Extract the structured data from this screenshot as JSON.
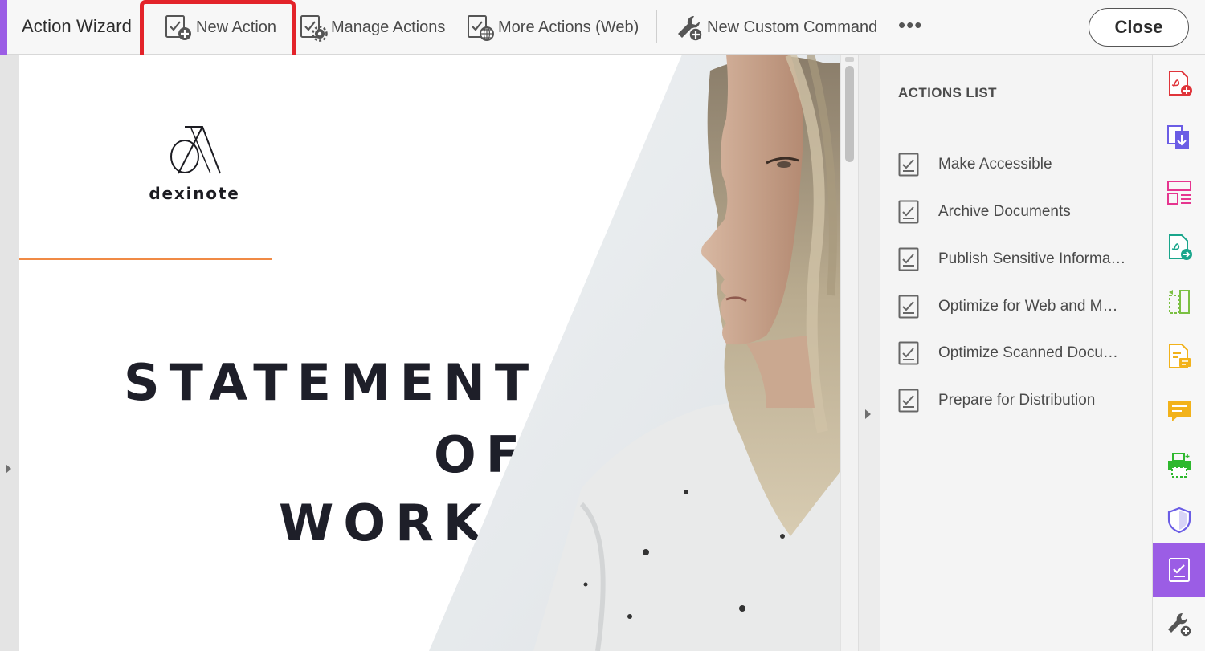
{
  "toolbar": {
    "title": "Action Wizard",
    "accent_color": "#9b5de5",
    "buttons": [
      {
        "label": "New Action",
        "icon": "checklist-plus-icon"
      },
      {
        "label": "Manage Actions",
        "icon": "checklist-gear-icon"
      },
      {
        "label": "More Actions (Web)",
        "icon": "checklist-globe-icon"
      },
      {
        "label": "New Custom Command",
        "icon": "wrench-plus-icon"
      }
    ],
    "more_label": "•••",
    "close_label": "Close",
    "highlight_color": "#e3232a"
  },
  "document": {
    "logo_text": "dexinote",
    "headline": [
      "STATEMENT",
      "OF",
      "WORK"
    ],
    "accent_line_color": "#f08a45"
  },
  "actions_panel": {
    "title": "ACTIONS LIST",
    "items": [
      "Make Accessible",
      "Archive Documents",
      "Publish Sensitive Informa…",
      "Optimize for Web and M…",
      "Optimize Scanned Docu…",
      "Prepare for Distribution"
    ]
  },
  "tools_rail": {
    "items": [
      {
        "icon": "create-pdf-icon",
        "color": "#e0353b"
      },
      {
        "icon": "export-pdf-icon",
        "color": "#6b5de5"
      },
      {
        "icon": "edit-pdf-icon",
        "color": "#e6358f"
      },
      {
        "icon": "send-pdf-icon",
        "color": "#1aa68c"
      },
      {
        "icon": "organize-pages-icon",
        "color": "#7bc043"
      },
      {
        "icon": "fill-sign-icon",
        "color": "#f2b21b"
      },
      {
        "icon": "comment-icon",
        "color": "#f2b21b"
      },
      {
        "icon": "print-production-icon",
        "color": "#2eb82e"
      },
      {
        "icon": "protect-shield-icon",
        "color": "#6b5de5"
      },
      {
        "icon": "action-wizard-icon",
        "color": "#ffffff",
        "active": true
      },
      {
        "icon": "more-tools-wrench-icon",
        "color": "#555555"
      }
    ]
  }
}
